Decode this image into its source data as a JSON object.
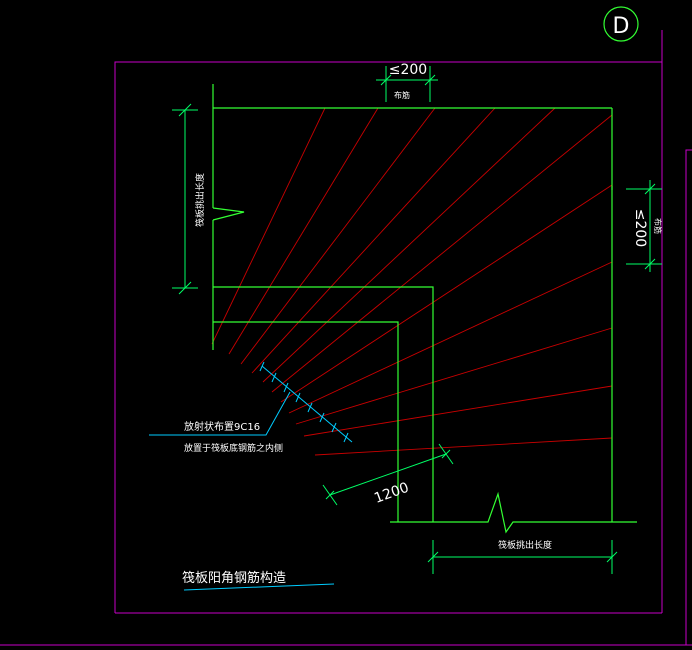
{
  "colors": {
    "background": "#000000",
    "frame": "#c800c8",
    "structure": "#33ff33",
    "bars": "#c80000",
    "dimension": "#00ff66",
    "text": "#ffffff",
    "leader": "#00ccff"
  },
  "grid_bubble": {
    "label": "D"
  },
  "dimensions": {
    "top_spacing": "≤200",
    "top_sub": "布筋",
    "right_spacing": "≤200",
    "right_sub": "布筋",
    "diagonal_length": "1200",
    "left_extension": "筏板挑出长度",
    "bottom_extension": "筏板挑出长度"
  },
  "annotation": {
    "line1": "放射状布置9C16",
    "line2": "放置于筏板底钢筋之内侧"
  },
  "drawing_title": "筏板阳角钢筋构造"
}
